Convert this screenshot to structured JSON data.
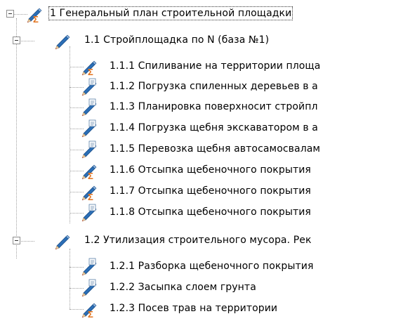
{
  "tree": {
    "root": {
      "label": "1 Генеральный план строительной площадки",
      "icon": "pencil-sigma-icon"
    },
    "groups": [
      {
        "label": "1.1 Стройплощадка по N (база №1)",
        "icon": "pencil-icon",
        "items": [
          {
            "label": "1.1.1 Спиливание на территории площа",
            "icon": "pencil-sigma-icon"
          },
          {
            "label": "1.1.2 Погрузка спиленных деревьев в а",
            "icon": "pencil-doc-icon"
          },
          {
            "label": "1.1.3 Планировка поверхносит стройпл",
            "icon": "pencil-doc-icon"
          },
          {
            "label": "1.1.4 Погрузка щебня экскаватором в а",
            "icon": "pencil-doc-icon"
          },
          {
            "label": "1.1.5 Перевозка щебня автосамосвалам",
            "icon": "pencil-doc-icon"
          },
          {
            "label": "1.1.6 Отсыпка щебеночного покрытия",
            "icon": "pencil-sigma-icon"
          },
          {
            "label": "1.1.7 Отсыпка щебеночного покрытия",
            "icon": "pencil-sigma-icon"
          },
          {
            "label": "1.1.8 Отсыпка щебеночного покрытия",
            "icon": "pencil-doc-icon"
          }
        ]
      },
      {
        "label": "1.2 Утилизация строительного мусора. Рек",
        "icon": "pencil-icon",
        "items": [
          {
            "label": "1.2.1 Разборка щебеночного покрытия",
            "icon": "pencil-doc-icon"
          },
          {
            "label": "1.2.2 Засыпка слоем грунта",
            "icon": "pencil-doc-icon"
          },
          {
            "label": "1.2.3 Посев трав на территории",
            "icon": "pencil-sigma-icon"
          }
        ]
      }
    ]
  },
  "colors": {
    "pencil": "#2c6fb6",
    "sigma": "#e2721c",
    "tip": "#d93030",
    "lines": "#a0a0a0"
  }
}
